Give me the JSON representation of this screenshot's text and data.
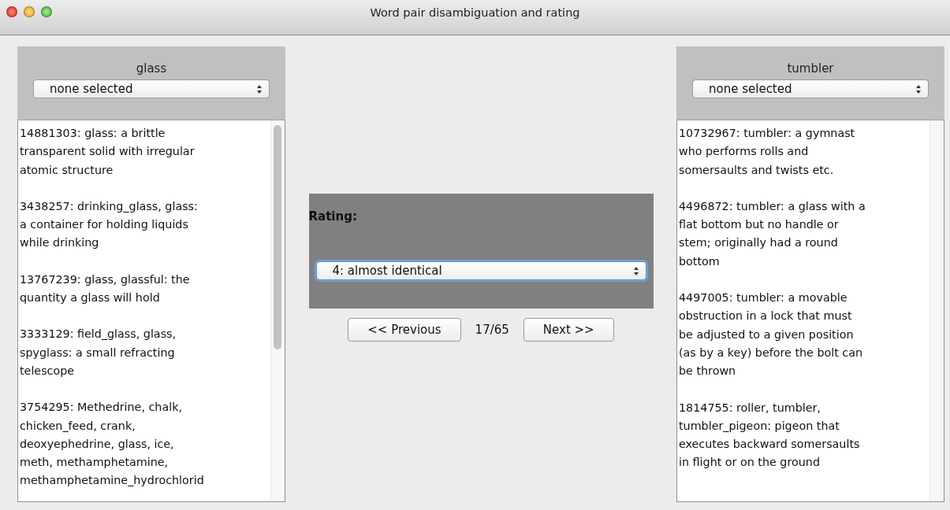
{
  "window": {
    "title": "Word pair disambiguation and rating"
  },
  "left": {
    "word": "glass",
    "sense_select": {
      "value": "none selected"
    },
    "senses": [
      {
        "lines": [
          "14881303: glass: a brittle",
          "transparent solid with irregular",
          "atomic structure"
        ]
      },
      {
        "lines": [
          "3438257: drinking_glass, glass:",
          "a container for holding liquids",
          "while drinking"
        ]
      },
      {
        "lines": [
          "13767239: glass, glassful: the",
          "quantity a glass will hold"
        ]
      },
      {
        "lines": [
          "3333129: field_glass, glass,",
          "spyglass: a small refracting",
          "telescope"
        ]
      },
      {
        "lines": [
          "3754295: Methedrine, chalk,",
          "chicken_feed, crank,",
          "deoxyephedrine, glass, ice,",
          "meth, methamphetamine,",
          "methamphetamine_hydrochlorid"
        ]
      }
    ],
    "scrollable": true
  },
  "rating": {
    "label": "Rating:",
    "select": {
      "value": "4: almost identical",
      "focused": true
    }
  },
  "navigation": {
    "previous": "<< Previous",
    "counter": "17/65",
    "next": "Next >>"
  },
  "right": {
    "word": "tumbler",
    "sense_select": {
      "value": "none selected"
    },
    "senses": [
      {
        "lines": [
          "10732967: tumbler: a gymnast",
          "who performs rolls and",
          "somersaults and twists etc."
        ]
      },
      {
        "lines": [
          "4496872: tumbler: a glass with a",
          "flat bottom but no handle or",
          "stem; originally had a round",
          "bottom"
        ]
      },
      {
        "lines": [
          "4497005: tumbler: a movable",
          "obstruction in a lock that must",
          "be adjusted to a given position",
          "(as by a key) before the bolt can",
          "be thrown"
        ]
      },
      {
        "lines": [
          "1814755: roller, tumbler,",
          "tumbler_pigeon: pigeon that",
          "executes backward somersaults",
          "in flight or on the ground"
        ]
      }
    ],
    "scrollable": false
  }
}
